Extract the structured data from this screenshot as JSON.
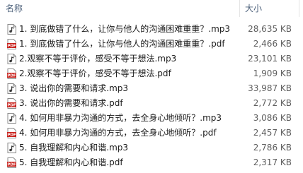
{
  "header": {
    "name_label": "名称",
    "size_label": "大小",
    "sort_indicator": "˄"
  },
  "files": [
    {
      "name": "1. 到底做错了什么，让你与他人的沟通困难重重？.mp3",
      "size": "28,635 KB",
      "type": "mp3",
      "icon": "audio-file-icon"
    },
    {
      "name": "1. 到底做错了什么，让你与他人的沟通困难重重？.pdf",
      "size": "2,466 KB",
      "type": "pdf",
      "icon": "pdf-file-icon"
    },
    {
      "name": "2.观察不等于评价，感受不等于想法.mp3",
      "size": "23,101 KB",
      "type": "mp3",
      "icon": "audio-file-icon"
    },
    {
      "name": "2.观察不等于评价，感受不等于想法.pdf",
      "size": "1,909 KB",
      "type": "pdf",
      "icon": "pdf-file-icon"
    },
    {
      "name": "3. 说出你的需要和请求.mp3",
      "size": "33,987 KB",
      "type": "mp3",
      "icon": "audio-file-icon"
    },
    {
      "name": "3. 说出你的需要和请求.pdf",
      "size": "2,772 KB",
      "type": "pdf",
      "icon": "pdf-file-icon"
    },
    {
      "name": "4. 如何用非暴力沟通的方式，去全身心地倾听？.mp3",
      "size": "3,086 KB",
      "type": "mp3",
      "icon": "audio-file-icon"
    },
    {
      "name": "4. 如何用非暴力沟通的方式，去全身心地倾听？.pdf",
      "size": "2,457 KB",
      "type": "pdf",
      "icon": "pdf-file-icon"
    },
    {
      "name": "5. 自我理解和内心和谐.mp3",
      "size": "2,786 KB",
      "type": "mp3",
      "icon": "audio-file-icon"
    },
    {
      "name": "5. 自我理解和内心和谐.pdf",
      "size": "2,317 KB",
      "type": "pdf",
      "icon": "pdf-file-icon"
    }
  ],
  "colors": {
    "header_text": "#4c607a",
    "pdf_icon": "#c8211c",
    "audio_icon": "#3a3a3a",
    "size_text": "#5f5f5f"
  }
}
